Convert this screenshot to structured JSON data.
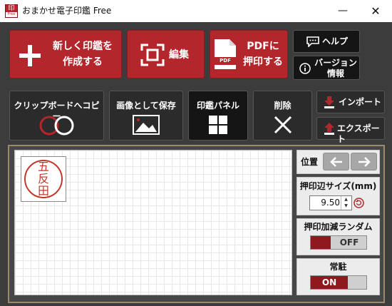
{
  "window": {
    "title": "おまかせ電子印鑑 Free",
    "app_icon_text": "印",
    "app_icon_subtext": "Free",
    "minimize_glyph": "—",
    "close_glyph": "✕"
  },
  "toolbar": {
    "new_stamp_line1": "新しく印鑑を",
    "new_stamp_line2": "作成する",
    "edit_label": "編集",
    "pdf_line1": "PDFに",
    "pdf_line2": "押印する",
    "pdf_icon_text": "PDF",
    "help_label": "ヘルプ",
    "version_line1": "バージョン",
    "version_line2": "情報"
  },
  "actions": {
    "copy_label": "クリップボードへコピー",
    "save_image_label": "画像として保存",
    "stamp_panel_label": "印鑑パネル",
    "delete_label": "削除",
    "import_label": "インポート",
    "export_label": "エクスポート"
  },
  "stamp": {
    "characters": [
      "五",
      "反",
      "田"
    ],
    "color": "#c0392b"
  },
  "side": {
    "position_label": "位置",
    "size_label": "押印辺サイズ(mm)",
    "size_value": "9.50",
    "random_label": "押印加減ランダム",
    "random_state": "OFF",
    "resident_label": "常駐",
    "resident_state": "ON"
  },
  "colors": {
    "accent_red": "#b3262c",
    "dark_bg": "#3c3c3c",
    "button_dark": "#2b2b2b",
    "frame_gold": "#9a8a6a"
  }
}
